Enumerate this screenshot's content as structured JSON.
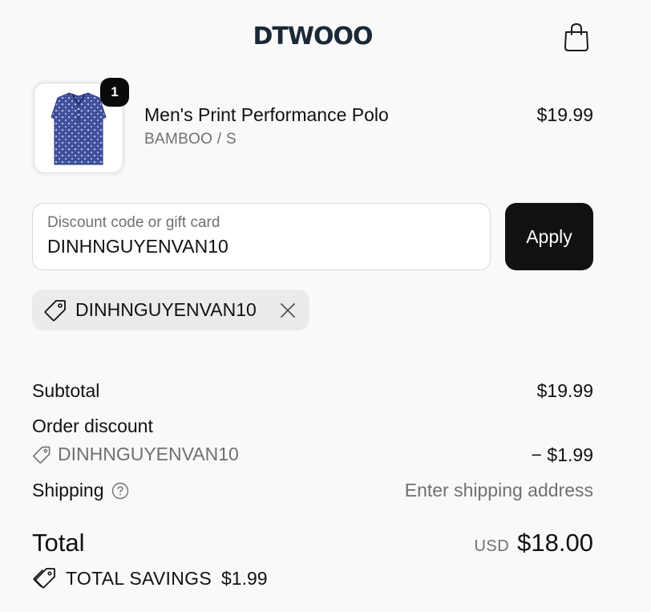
{
  "header": {
    "logo": "DTWOOO",
    "cart_icon": "shopping-bag-icon"
  },
  "line_item": {
    "name": "Men's Print Performance Polo",
    "variant": "BAMBOO / S",
    "price": "$19.99",
    "quantity": "1",
    "image_icon": "polo-shirt-image"
  },
  "discount": {
    "placeholder": "Discount code or gift card",
    "value": "DINHNGUYENVAN10",
    "apply_label": "Apply",
    "applied_code": "DINHNGUYENVAN10",
    "tag_icon": "tag-icon",
    "remove_icon": "close-icon"
  },
  "summary": {
    "subtotal_label": "Subtotal",
    "subtotal_value": "$19.99",
    "order_discount_label": "Order discount",
    "discount_code": "DINHNGUYENVAN10",
    "discount_value": "− $1.99",
    "shipping_label": "Shipping",
    "shipping_value": "Enter shipping address",
    "shipping_help_icon": "question-circle-icon",
    "total_label": "Total",
    "currency": "USD",
    "total_value": "$18.00",
    "savings_label": "TOTAL SAVINGS",
    "savings_value": "$1.99"
  },
  "colors": {
    "background": "#f9f9f9",
    "button": "#111111",
    "muted_text": "#707070",
    "logo": "#1b2836",
    "polo": "#3e4f9a"
  }
}
